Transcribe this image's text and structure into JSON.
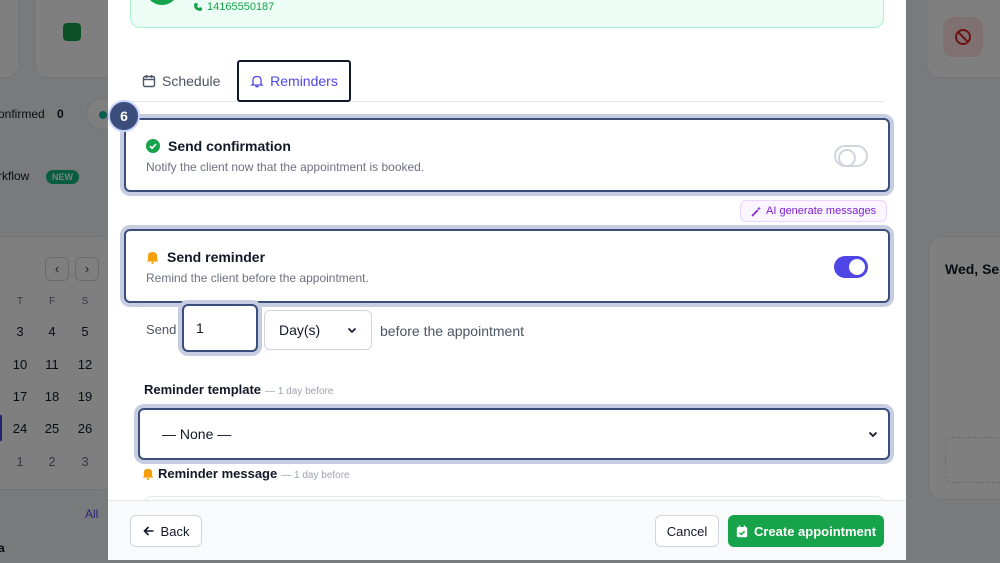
{
  "background": {
    "status_label": "onfirmed",
    "status_count": "0",
    "workflow_label": "rkflow",
    "new_badge": "NEW",
    "calendar": {
      "day_heads": [
        "T",
        "F",
        "S"
      ],
      "rows": [
        [
          "3",
          "4",
          "5"
        ],
        [
          "10",
          "11",
          "12"
        ],
        [
          "17",
          "18",
          "19"
        ],
        [
          "24",
          "25",
          "26"
        ],
        [
          "1",
          "2",
          "3"
        ]
      ]
    },
    "all_link": "All",
    "right_date": "Wed, Se",
    "bottom_left": "a"
  },
  "modal": {
    "client_phone": "14165550187",
    "tabs": [
      {
        "label": "Schedule",
        "active": false
      },
      {
        "label": "Reminders",
        "active": true
      }
    ],
    "step_number": "6",
    "confirmation": {
      "title": "Send confirmation",
      "description": "Notify the client now that the appointment is booked.",
      "enabled": false
    },
    "ai_button": "AI generate messages",
    "reminder": {
      "title": "Send reminder",
      "description": "Remind the client before the appointment.",
      "enabled": true
    },
    "send_prefix": "Send",
    "send_amount": "1",
    "send_unit": "Day(s)",
    "send_suffix": "before the appointment",
    "template_label": "Reminder template",
    "template_sublabel": "— 1 day before",
    "template_value": "— None —",
    "message_label": "Reminder message",
    "message_sublabel": "— 1 day before"
  },
  "footer": {
    "back": "Back",
    "cancel": "Cancel",
    "create": "Create appointment"
  },
  "colors": {
    "primary": "#4f46e5",
    "success": "#16a34a",
    "focus_ring": "#3b4d7a"
  }
}
